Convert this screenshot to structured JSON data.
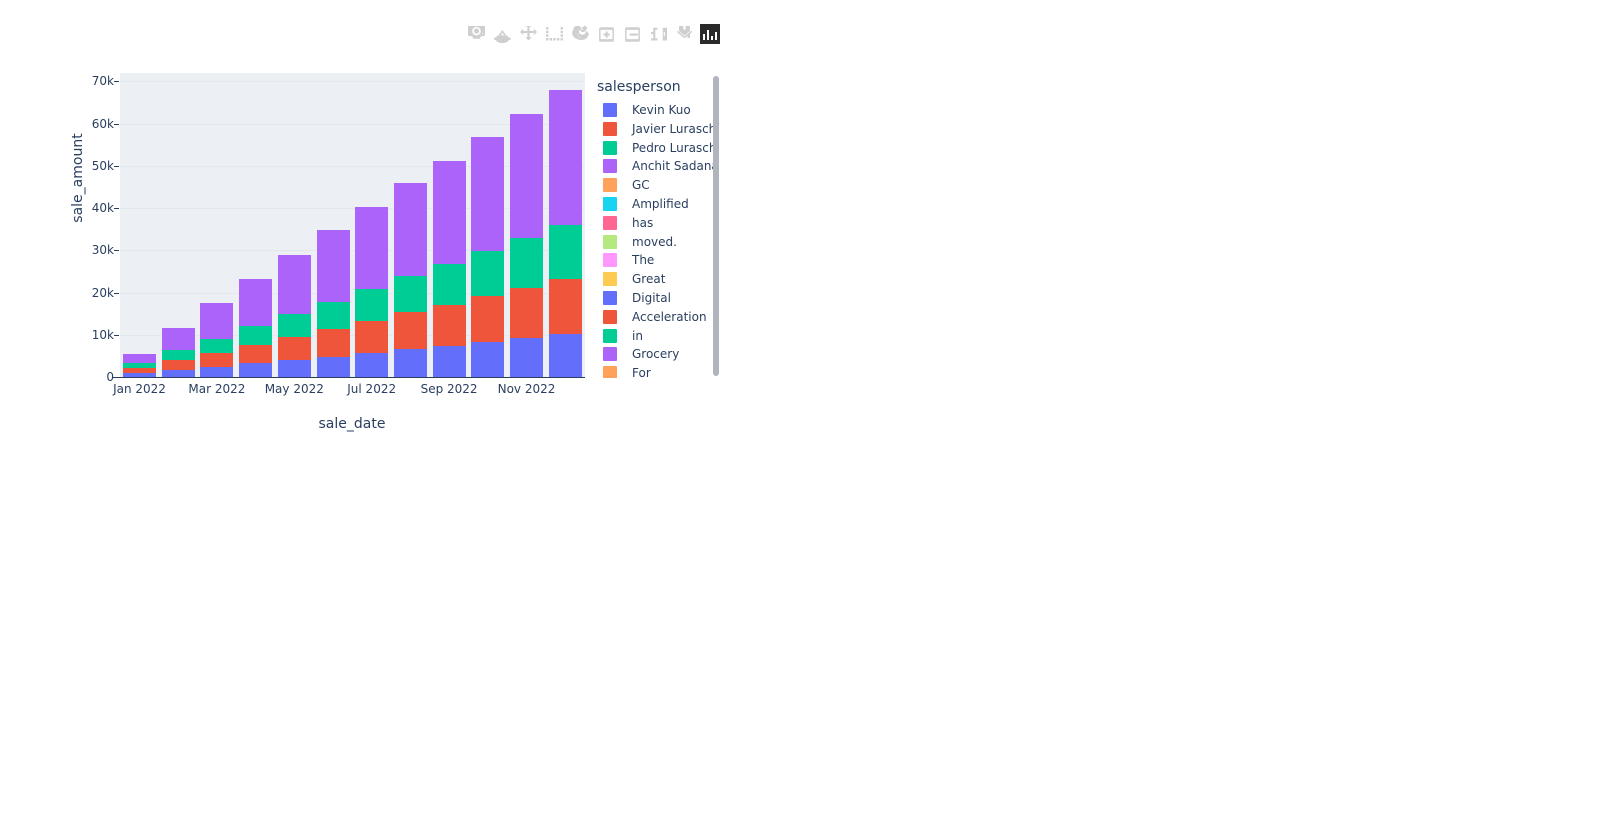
{
  "modebar": {
    "buttons": [
      {
        "name": "download-plot-icon",
        "label": "Download plot as a png"
      },
      {
        "name": "zoom-icon",
        "label": "Zoom"
      },
      {
        "name": "pan-icon",
        "label": "Pan"
      },
      {
        "name": "box-select-icon",
        "label": "Box Select"
      },
      {
        "name": "lasso-select-icon",
        "label": "Lasso Select"
      },
      {
        "name": "zoom-in-icon",
        "label": "Zoom in"
      },
      {
        "name": "zoom-out-icon",
        "label": "Zoom out"
      },
      {
        "name": "autoscale-icon",
        "label": "Autoscale"
      },
      {
        "name": "reset-axes-home-icon",
        "label": "Reset axes"
      },
      {
        "name": "plotly-logo-icon",
        "label": "Produced with Plotly"
      }
    ]
  },
  "legend": {
    "title": "salesperson",
    "items": [
      {
        "label": "Kevin Kuo",
        "color": "#636efa"
      },
      {
        "label": "Javier Luraschi",
        "color": "#ef553b"
      },
      {
        "label": "Pedro Luraschi",
        "color": "#00cc96"
      },
      {
        "label": "Anchit Sadana",
        "color": "#ab63fa"
      },
      {
        "label": "GC",
        "color": "#ffa15a"
      },
      {
        "label": "Amplified",
        "color": "#19d3f3"
      },
      {
        "label": "has",
        "color": "#ff6692"
      },
      {
        "label": "moved.",
        "color": "#b6e880"
      },
      {
        "label": "The",
        "color": "#ff97ff"
      },
      {
        "label": "Great",
        "color": "#fecb52"
      },
      {
        "label": "Digital",
        "color": "#636efa"
      },
      {
        "label": "Acceleration",
        "color": "#ef553b"
      },
      {
        "label": "in",
        "color": "#00cc96"
      },
      {
        "label": "Grocery",
        "color": "#ab63fa"
      },
      {
        "label": "For",
        "color": "#ffa15a"
      }
    ]
  },
  "chart_data": {
    "type": "bar",
    "barmode": "stacked",
    "title": "",
    "xlabel": "sale_date",
    "ylabel": "sale_amount",
    "ylim": [
      0,
      72000
    ],
    "grid": true,
    "legend_position": "right",
    "categories": [
      "Jan 2022",
      "Feb 2022",
      "Mar 2022",
      "Apr 2022",
      "May 2022",
      "Jun 2022",
      "Jul 2022",
      "Aug 2022",
      "Sep 2022",
      "Oct 2022",
      "Nov 2022",
      "Dec 2022"
    ],
    "x_tick_labels": [
      "Jan 2022",
      "Mar 2022",
      "May 2022",
      "Jul 2022",
      "Sep 2022",
      "Nov 2022"
    ],
    "y_tick_labels": [
      "0",
      "10k",
      "20k",
      "30k",
      "40k",
      "50k",
      "60k",
      "70k"
    ],
    "y_tick_values": [
      0,
      10000,
      20000,
      30000,
      40000,
      50000,
      60000,
      70000
    ],
    "series": [
      {
        "name": "Kevin Kuo",
        "color": "#636efa",
        "values": [
          900,
          1700,
          2400,
          3300,
          4000,
          4800,
          5700,
          6600,
          7400,
          8300,
          9200,
          10200
        ]
      },
      {
        "name": "Javier Luraschi",
        "color": "#ef553b",
        "values": [
          1300,
          2300,
          3300,
          4400,
          5500,
          6500,
          7600,
          8700,
          9700,
          10800,
          12000,
          13000
        ]
      },
      {
        "name": "Pedro Luraschi",
        "color": "#00cc96",
        "values": [
          1200,
          2300,
          3300,
          4400,
          5400,
          6500,
          7500,
          8600,
          9600,
          10700,
          11700,
          12800
        ]
      },
      {
        "name": "Anchit Sadana",
        "color": "#ab63fa",
        "values": [
          2100,
          5200,
          8600,
          11200,
          14000,
          17000,
          19500,
          22000,
          24500,
          27000,
          29500,
          32000
        ]
      }
    ],
    "totals": [
      5500,
      11500,
      17600,
      23300,
      28900,
      34800,
      40300,
      45900,
      51200,
      56800,
      62400,
      68000
    ]
  }
}
